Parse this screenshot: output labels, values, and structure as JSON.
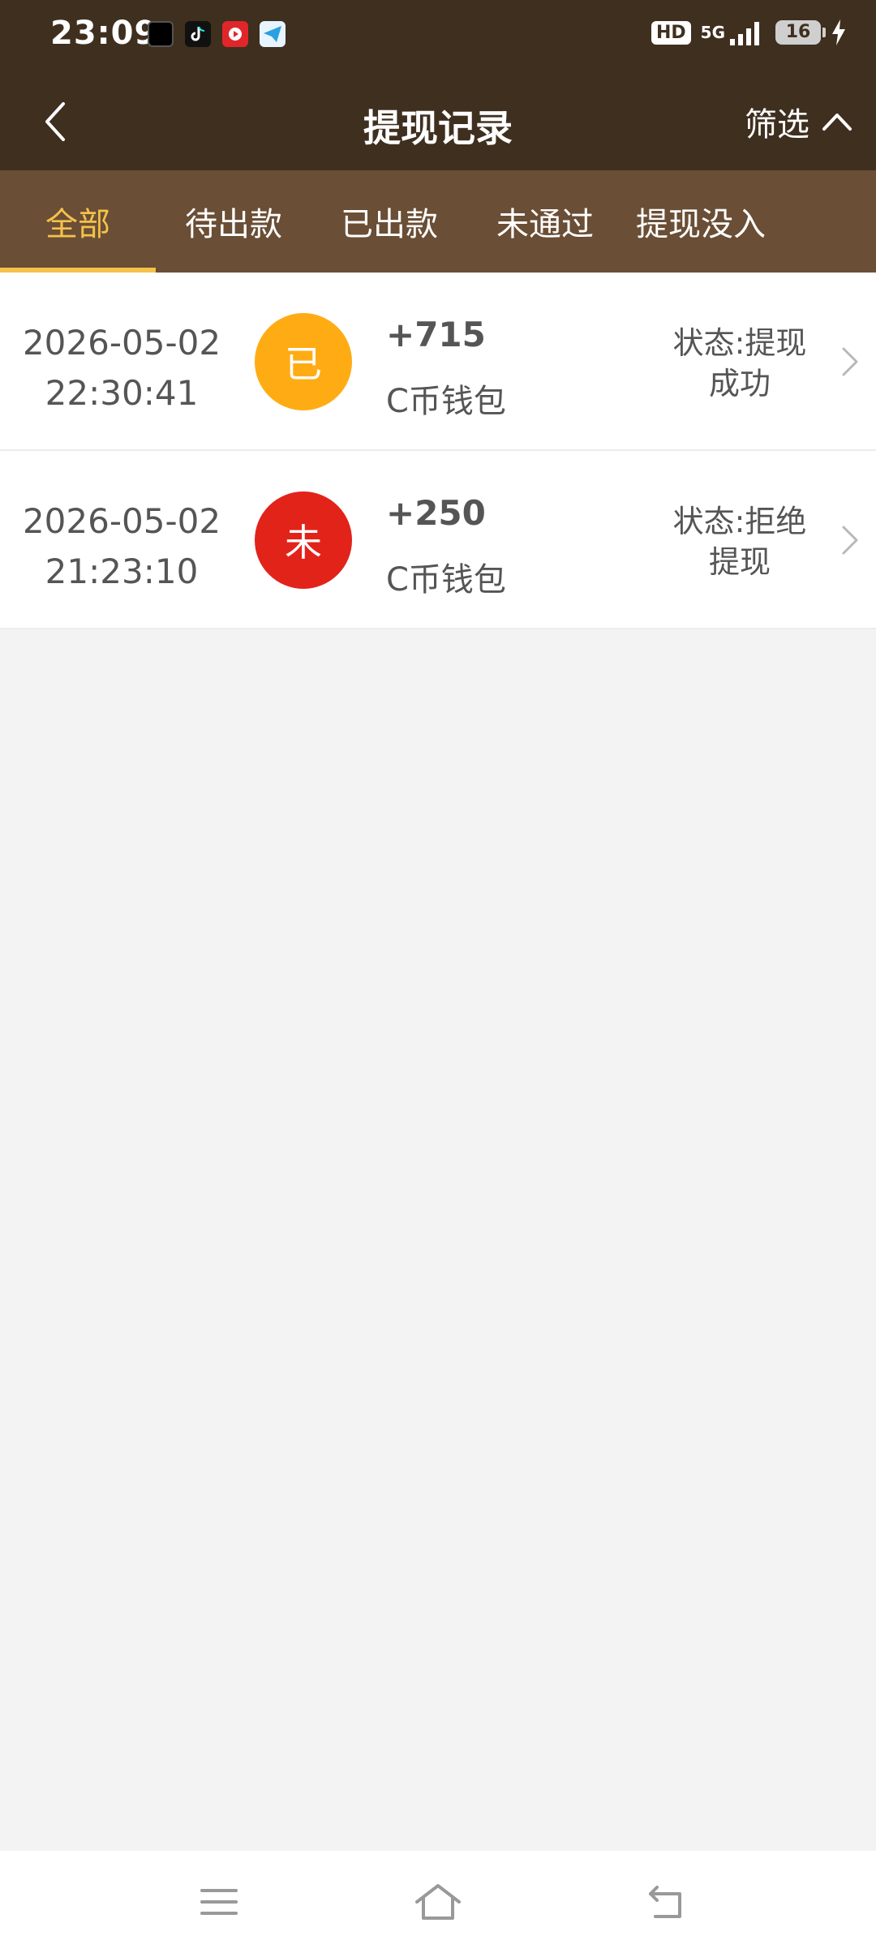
{
  "status_bar": {
    "time": "23:09",
    "hd_label": "HD",
    "network_label": "5G",
    "battery_level": "16",
    "apps": [
      {
        "name": "hot-app-icon",
        "color": "#000000"
      },
      {
        "name": "tiktok-icon",
        "color": "#111111"
      },
      {
        "name": "video-app-icon",
        "color": "#e0262a"
      },
      {
        "name": "telegram-like-icon",
        "color": "#2aa0e0"
      }
    ]
  },
  "header": {
    "title": "提现记录",
    "filter_label": "筛选"
  },
  "tabs": [
    {
      "label": "全部",
      "active": true
    },
    {
      "label": "待出款",
      "active": false
    },
    {
      "label": "已出款",
      "active": false
    },
    {
      "label": "未通过",
      "active": false
    },
    {
      "label": "提现没入",
      "active": false
    }
  ],
  "records": [
    {
      "date": "2026-05-02",
      "time": "22:30:41",
      "badge": "已",
      "badge_color": "#ffac14",
      "amount": "+715",
      "wallet": "C币钱包",
      "status_line1": "状态:提现",
      "status_line2": "成功"
    },
    {
      "date": "2026-05-02",
      "time": "21:23:10",
      "badge": "未",
      "badge_color": "#e2231a",
      "amount": "+250",
      "wallet": "C币钱包",
      "status_line1": "状态:拒绝",
      "status_line2": "提现"
    }
  ],
  "colors": {
    "header_bg": "#3f2f1f",
    "tabs_bg": "#6a4e35",
    "active_tab": "#f4c24b",
    "page_bg": "#f3f3f3"
  }
}
